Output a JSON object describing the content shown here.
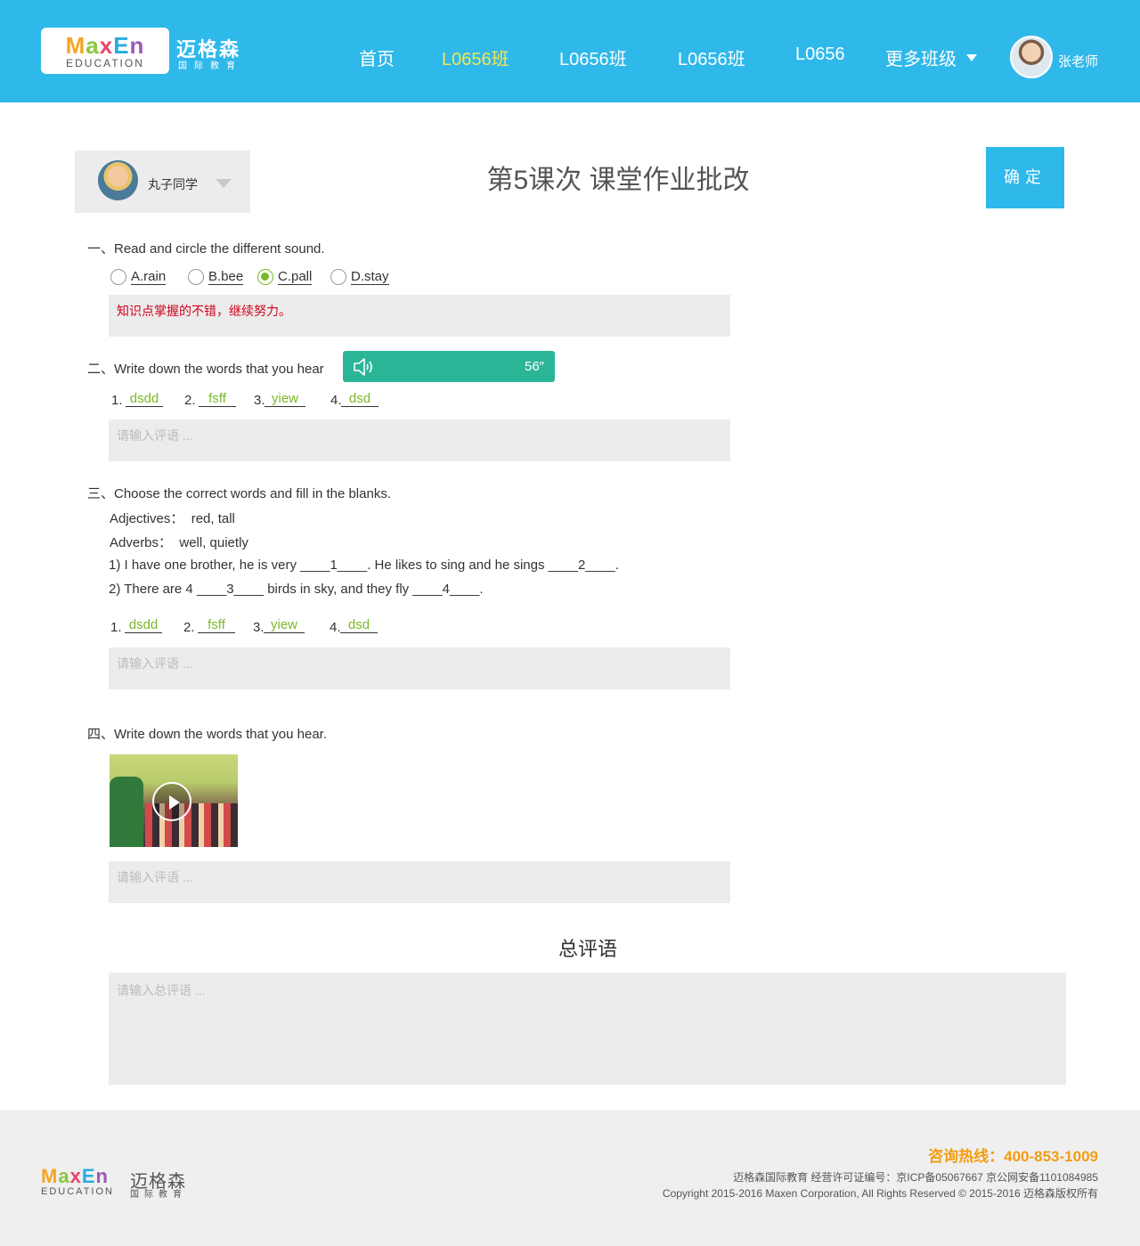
{
  "header": {
    "logo_en": [
      "M",
      "a",
      "x",
      "E",
      "n"
    ],
    "logo_sub": "EDUCATION",
    "logo_cn": "迈格森",
    "logo_cn_sub": "国际教育",
    "nav": [
      {
        "label": "首页",
        "active": false
      },
      {
        "label": "L0656班",
        "active": true
      },
      {
        "label": "L0656班",
        "active": false
      },
      {
        "label": "L0656班",
        "active": false
      },
      {
        "label": "L0656",
        "active": false
      },
      {
        "label": "更多班级",
        "active": false
      }
    ],
    "teacher_name": "张老师"
  },
  "student": {
    "name": "丸子同学"
  },
  "page_title": "第5课次 课堂作业批改",
  "confirm_label": "确定",
  "q1": {
    "title": "一、Read and circle the different sound.",
    "options": [
      {
        "label": "A.rain",
        "checked": false
      },
      {
        "label": "B.bee",
        "checked": false
      },
      {
        "label": "C.pall",
        "checked": true
      },
      {
        "label": "D.stay",
        "checked": false
      }
    ],
    "comment": "知识点掌握的不错，继续努力。"
  },
  "q2": {
    "title": "二、Write down the words that you hear",
    "audio_duration": "56″",
    "answers": [
      {
        "num": "1.",
        "value": "dsdd"
      },
      {
        "num": "2.",
        "value": "fsff"
      },
      {
        "num": "3.",
        "value": "yiew"
      },
      {
        "num": "4.",
        "value": "dsd"
      }
    ],
    "comment_placeholder": "请输入评语 ..."
  },
  "q3": {
    "title": "三、Choose the correct words and fill in the blanks.",
    "adjectives": "Adjectives：  red, tall",
    "adverbs": "Adverbs：  well, quietly",
    "sentence1": "1) I have one brother, he is very ____1____. He likes to sing and he sings ____2____.",
    "sentence2": "2) There are 4 ____3____ birds in sky, and they fly ____4____.",
    "answers": [
      {
        "num": "1.",
        "value": "dsdd"
      },
      {
        "num": "2.",
        "value": "fsff"
      },
      {
        "num": "3.",
        "value": "yiew"
      },
      {
        "num": "4.",
        "value": "dsd"
      }
    ],
    "comment_placeholder": "请输入评语 ..."
  },
  "q4": {
    "title": "四、Write down the words that you hear.",
    "comment_placeholder": "请输入评语 ..."
  },
  "summary": {
    "title": "总评语",
    "placeholder": "请输入总评语 ..."
  },
  "footer": {
    "logo_cn": "迈格森",
    "logo_sub": "EDUCATION",
    "logo_cn_sub": "国际教育",
    "hotline": "咨询热线：400-853-1009",
    "icp": "迈格森国际教育 经营许可证编号：京ICP备05067667  京公网安备1101084985",
    "copyright": "Copyright 2015-2016 Maxen Corporation, All Rights Reserved © 2015-2016 迈格森版权所有"
  },
  "colors": {
    "brand_blue": "#2fb8ea",
    "active_nav": "#f6e651",
    "answer_green": "#7ab829",
    "audio_green": "#2bb597",
    "comment_red": "#d0021b",
    "hotline_orange": "#f39c12"
  }
}
